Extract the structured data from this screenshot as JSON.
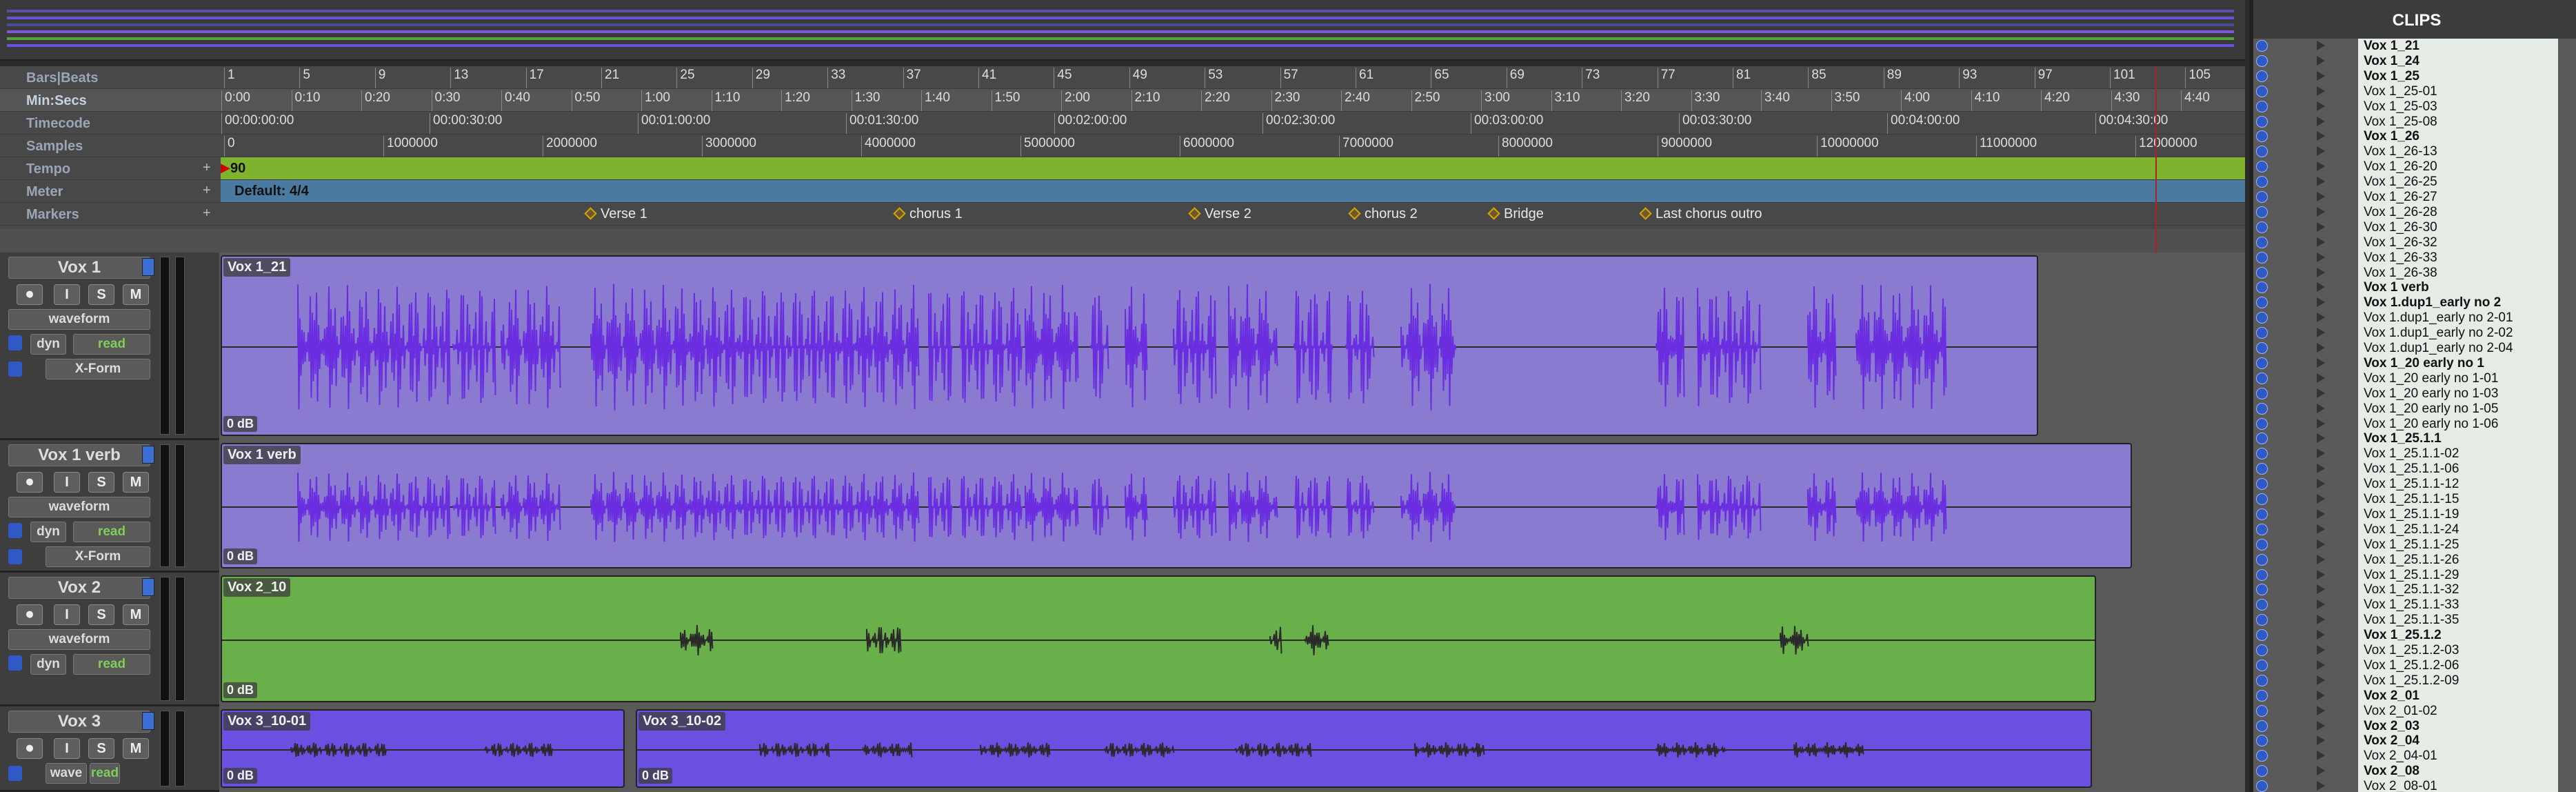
{
  "rulers": {
    "bars_label": "Bars|Beats",
    "minsecs_label": "Min:Secs",
    "timecode_label": "Timecode",
    "samples_label": "Samples",
    "tempo_label": "Tempo",
    "meter_label": "Meter",
    "markers_label": "Markers",
    "bars": [
      "1",
      "5",
      "9",
      "13",
      "17",
      "21",
      "25",
      "29",
      "33",
      "37",
      "41",
      "45",
      "49",
      "53",
      "57",
      "61",
      "65",
      "69",
      "73",
      "77",
      "81",
      "85",
      "89",
      "93",
      "97",
      "101",
      "105"
    ],
    "minsecs": [
      "0:00",
      "0:10",
      "0:20",
      "0:30",
      "0:40",
      "0:50",
      "1:00",
      "1:10",
      "1:20",
      "1:30",
      "1:40",
      "1:50",
      "2:00",
      "2:10",
      "2:20",
      "2:30",
      "2:40",
      "2:50",
      "3:00",
      "3:10",
      "3:20",
      "3:30",
      "3:40",
      "3:50",
      "4:00",
      "4:10",
      "4:20",
      "4:30",
      "4:40"
    ],
    "timecode": [
      "00:00:00:00",
      "00:00:30:00",
      "00:01:00:00",
      "00:01:30:00",
      "00:02:00:00",
      "00:02:30:00",
      "00:03:00:00",
      "00:03:30:00",
      "00:04:00:00",
      "00:04:30:00"
    ],
    "samples": [
      "0",
      "1000000",
      "2000000",
      "3000000",
      "4000000",
      "5000000",
      "6000000",
      "7000000",
      "8000000",
      "9000000",
      "10000000",
      "11000000",
      "12000000"
    ],
    "tempo_value": "90",
    "meter_value": "Default: 4/4",
    "markers": [
      "Verse 1",
      "chorus 1",
      "Verse 2",
      "chorus 2",
      "Bridge",
      "Last chorus outro"
    ]
  },
  "tracks": [
    {
      "name": "Vox 1",
      "view": "waveform",
      "insert": "dyn",
      "automation": "read",
      "send": "X-Form",
      "rec": "⏺",
      "input": "I",
      "solo": "S",
      "mute": "M",
      "clips": [
        {
          "name": "Vox 1_21",
          "gain": "0 dB"
        }
      ]
    },
    {
      "name": "Vox 1 verb",
      "view": "waveform",
      "insert": "dyn",
      "automation": "read",
      "send": "X-Form",
      "rec": "⏺",
      "input": "I",
      "solo": "S",
      "mute": "M",
      "clips": [
        {
          "name": "Vox 1 verb",
          "gain": "0 dB"
        }
      ]
    },
    {
      "name": "Vox 2",
      "view": "waveform",
      "insert": "dyn",
      "automation": "read",
      "rec": "⏺",
      "input": "I",
      "solo": "S",
      "mute": "M",
      "clips": [
        {
          "name": "Vox 2_10",
          "gain": "0 dB"
        }
      ]
    },
    {
      "name": "Vox 3",
      "view": "wave",
      "automation": "read",
      "rec": "⏺",
      "input": "I",
      "solo": "S",
      "mute": "M",
      "clips": [
        {
          "name": "Vox 3_10-01",
          "gain": "0 dB"
        },
        {
          "name": "Vox 3_10-02",
          "gain": "0 dB"
        }
      ]
    }
  ],
  "clips_panel": {
    "title": "CLIPS",
    "items": [
      {
        "name": "Vox 1_21",
        "bold": true
      },
      {
        "name": "Vox 1_24",
        "bold": true
      },
      {
        "name": "Vox 1_25",
        "bold": true
      },
      {
        "name": "Vox 1_25-01",
        "bold": false
      },
      {
        "name": "Vox 1_25-03",
        "bold": false
      },
      {
        "name": "Vox 1_25-08",
        "bold": false
      },
      {
        "name": "Vox 1_26",
        "bold": true
      },
      {
        "name": "Vox 1_26-13",
        "bold": false
      },
      {
        "name": "Vox 1_26-20",
        "bold": false
      },
      {
        "name": "Vox 1_26-25",
        "bold": false
      },
      {
        "name": "Vox 1_26-27",
        "bold": false
      },
      {
        "name": "Vox 1_26-28",
        "bold": false
      },
      {
        "name": "Vox 1_26-30",
        "bold": false
      },
      {
        "name": "Vox 1_26-32",
        "bold": false
      },
      {
        "name": "Vox 1_26-33",
        "bold": false
      },
      {
        "name": "Vox 1_26-38",
        "bold": false
      },
      {
        "name": "Vox 1 verb",
        "bold": true
      },
      {
        "name": "Vox 1.dup1_early no 2",
        "bold": true
      },
      {
        "name": "Vox 1.dup1_early no 2-01",
        "bold": false
      },
      {
        "name": "Vox 1.dup1_early no 2-02",
        "bold": false
      },
      {
        "name": "Vox 1.dup1_early no 2-04",
        "bold": false
      },
      {
        "name": "Vox 1_20 early no 1",
        "bold": true
      },
      {
        "name": "Vox 1_20 early no 1-01",
        "bold": false
      },
      {
        "name": "Vox 1_20 early no 1-03",
        "bold": false
      },
      {
        "name": "Vox 1_20 early no 1-05",
        "bold": false
      },
      {
        "name": "Vox 1_20 early no 1-06",
        "bold": false
      },
      {
        "name": "Vox 1_25.1.1",
        "bold": true
      },
      {
        "name": "Vox 1_25.1.1-02",
        "bold": false
      },
      {
        "name": "Vox 1_25.1.1-06",
        "bold": false
      },
      {
        "name": "Vox 1_25.1.1-12",
        "bold": false
      },
      {
        "name": "Vox 1_25.1.1-15",
        "bold": false
      },
      {
        "name": "Vox 1_25.1.1-19",
        "bold": false
      },
      {
        "name": "Vox 1_25.1.1-24",
        "bold": false
      },
      {
        "name": "Vox 1_25.1.1-25",
        "bold": false
      },
      {
        "name": "Vox 1_25.1.1-26",
        "bold": false
      },
      {
        "name": "Vox 1_25.1.1-29",
        "bold": false
      },
      {
        "name": "Vox 1_25.1.1-32",
        "bold": false
      },
      {
        "name": "Vox 1_25.1.1-33",
        "bold": false
      },
      {
        "name": "Vox 1_25.1.1-35",
        "bold": false
      },
      {
        "name": "Vox 1_25.1.2",
        "bold": true
      },
      {
        "name": "Vox 1_25.1.2-03",
        "bold": false
      },
      {
        "name": "Vox 1_25.1.2-06",
        "bold": false
      },
      {
        "name": "Vox 1_25.1.2-09",
        "bold": false
      },
      {
        "name": "Vox 2_01",
        "bold": true
      },
      {
        "name": "Vox 2_01-02",
        "bold": false
      },
      {
        "name": "Vox 2_03",
        "bold": true
      },
      {
        "name": "Vox 2_04",
        "bold": true
      },
      {
        "name": "Vox 2_04-01",
        "bold": false
      },
      {
        "name": "Vox 2_08",
        "bold": true
      },
      {
        "name": "Vox 2_08-01",
        "bold": false
      }
    ]
  },
  "colors": {
    "purple_clip": "#8a7ad0",
    "green_clip": "#6ab04a",
    "violet_clip": "#6a4fe0",
    "wave_purple": "#6a2ee0",
    "tempo_bar": "#7fb22e",
    "meter_bar": "#4a7aa0"
  }
}
